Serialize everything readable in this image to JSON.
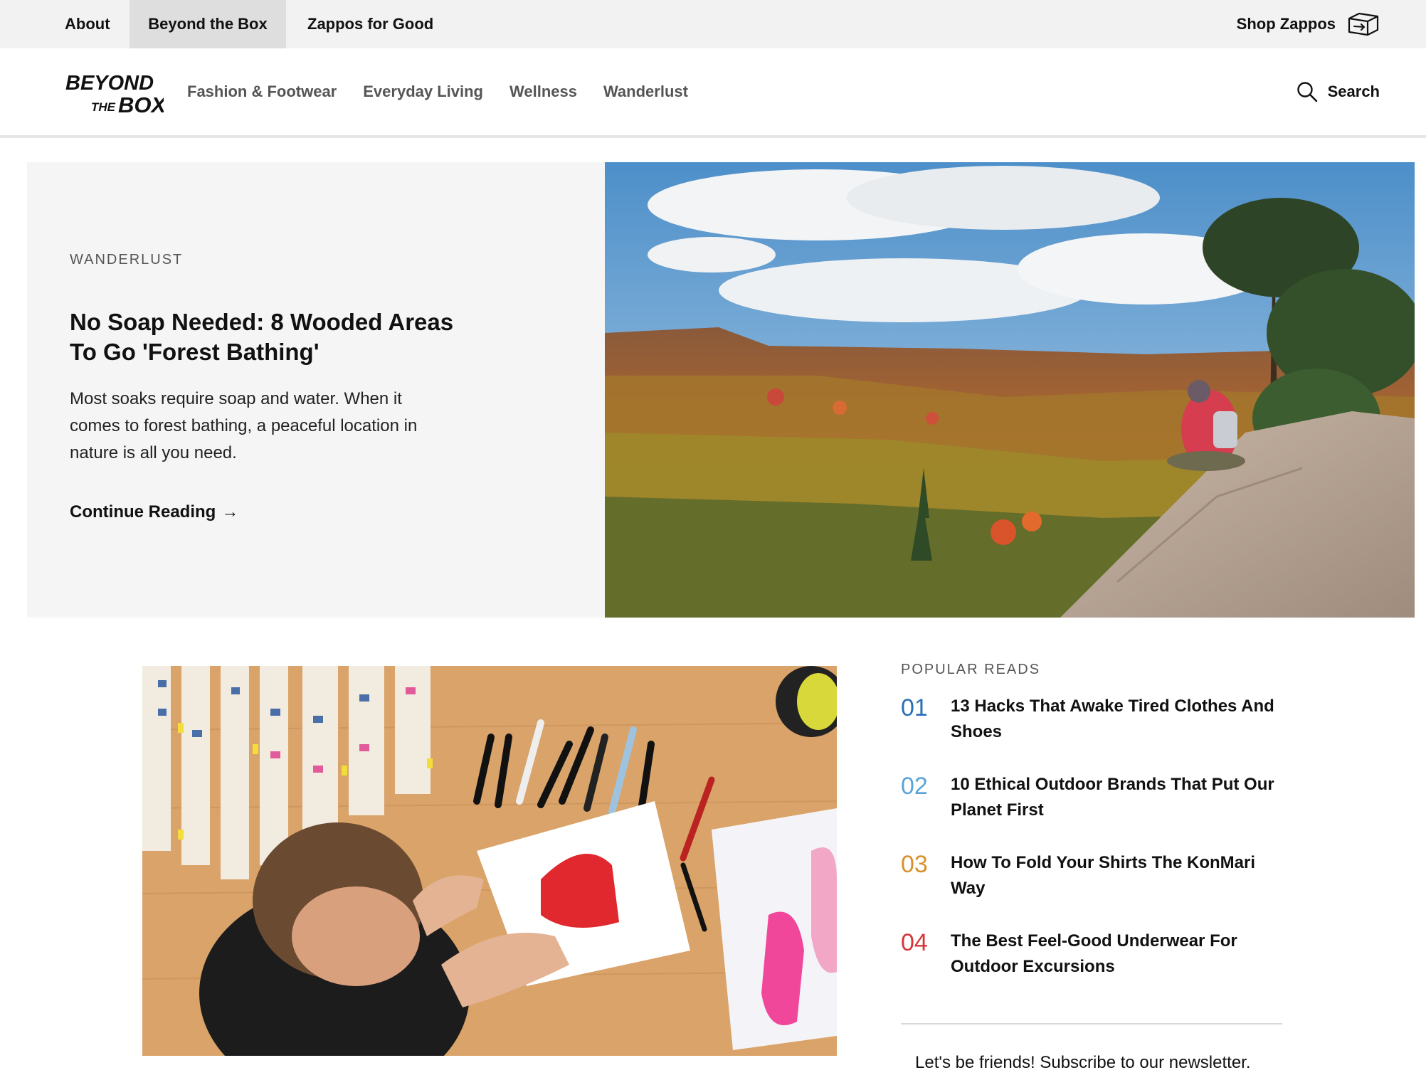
{
  "topbar": {
    "links": [
      "About",
      "Beyond the Box",
      "Zappos for Good"
    ],
    "shop_label": "Shop Zappos",
    "shop_icon": "box-icon"
  },
  "header": {
    "logo_line1": "BEYOND",
    "logo_the": "THE",
    "logo_box": "BOX",
    "nav": [
      "Fashion & Footwear",
      "Everyday Living",
      "Wellness",
      "Wanderlust"
    ],
    "search_label": "Search",
    "search_icon": "search-icon"
  },
  "hero": {
    "category": "WANDERLUST",
    "title": "No Soap Needed: 8 Wooded Areas To Go 'Forest Bathing'",
    "description": "Most soaks require soap and water. When it comes to forest bathing, a peaceful location in nature is all you need.",
    "cta": "Continue Reading",
    "cta_arrow": "→"
  },
  "popular": {
    "heading": "POPULAR READS",
    "items": [
      {
        "num": "01",
        "title": "13 Hacks That Awake Tired Clothes And Shoes",
        "color": "#2a6fb5"
      },
      {
        "num": "02",
        "title": "10 Ethical Outdoor Brands That Put Our Planet First",
        "color": "#5aa3d8"
      },
      {
        "num": "03",
        "title": "How To Fold Your Shirts The KonMari Way",
        "color": "#d9912a"
      },
      {
        "num": "04",
        "title": "The Best Feel-Good Underwear For Outdoor Excursions",
        "color": "#d6363b"
      }
    ]
  },
  "newsletter": {
    "text": "Let's be friends! Subscribe to our newsletter."
  }
}
